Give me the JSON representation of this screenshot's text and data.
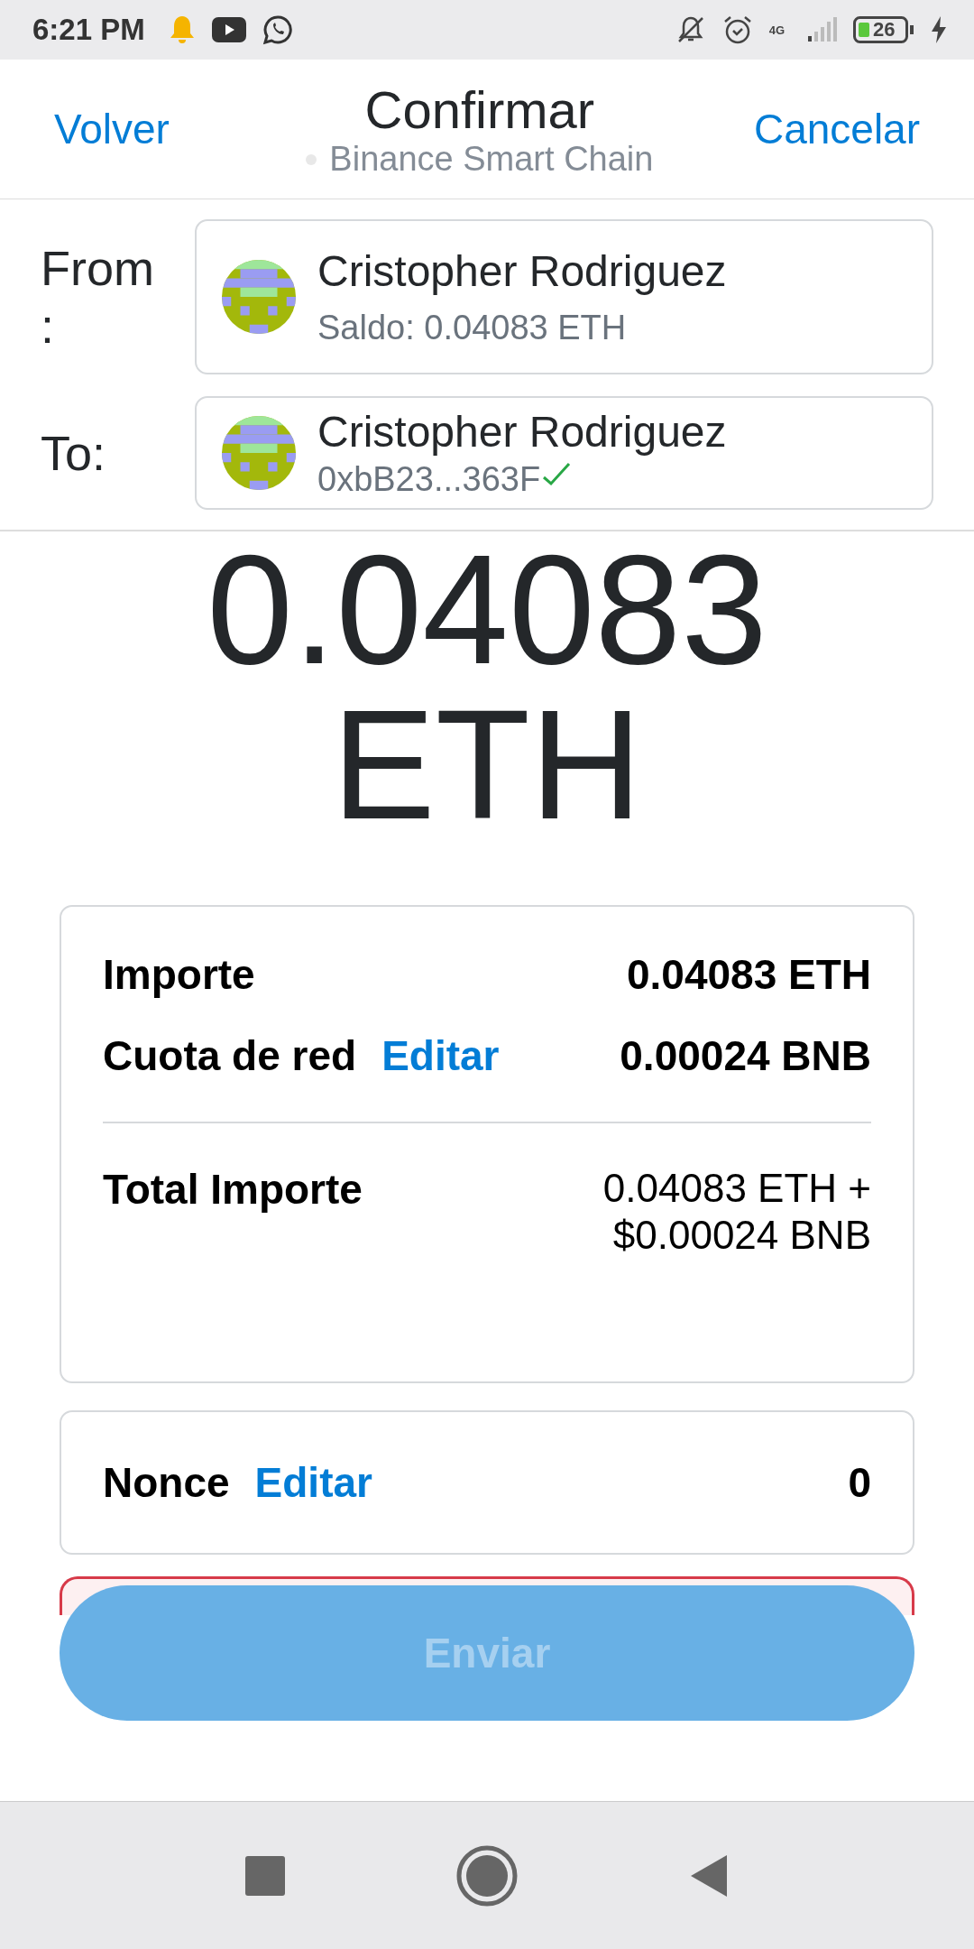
{
  "status_bar": {
    "time": "6:21 PM",
    "network": "4G",
    "battery": "26"
  },
  "header": {
    "back": "Volver",
    "title": "Confirmar",
    "network": "Binance Smart Chain",
    "cancel": "Cancelar"
  },
  "accounts": [
    {
      "label": "From\n:",
      "name": "Cristopher Rodriguez",
      "detail": "Saldo: 0.04083 ETH",
      "verified": false
    },
    {
      "label": "To:",
      "name": "Cristopher Rodriguez",
      "detail": "0xbB23...363F",
      "verified": true
    }
  ],
  "amount": {
    "value": "0.04083",
    "unit": "ETH"
  },
  "summary": {
    "rows": [
      {
        "label": "Importe",
        "value": "0.04083 ETH"
      },
      {
        "label": "Cuota de red",
        "edit": "Editar",
        "value": "0.00024 BNB"
      }
    ],
    "total": {
      "label": "Total Importe",
      "lines": [
        "0.04083 ETH +",
        "$0.00024 BNB"
      ]
    }
  },
  "nonce": {
    "label": "Nonce",
    "edit": "Editar",
    "value": "0"
  },
  "send_button": {
    "label": "Enviar",
    "disabled": true
  }
}
